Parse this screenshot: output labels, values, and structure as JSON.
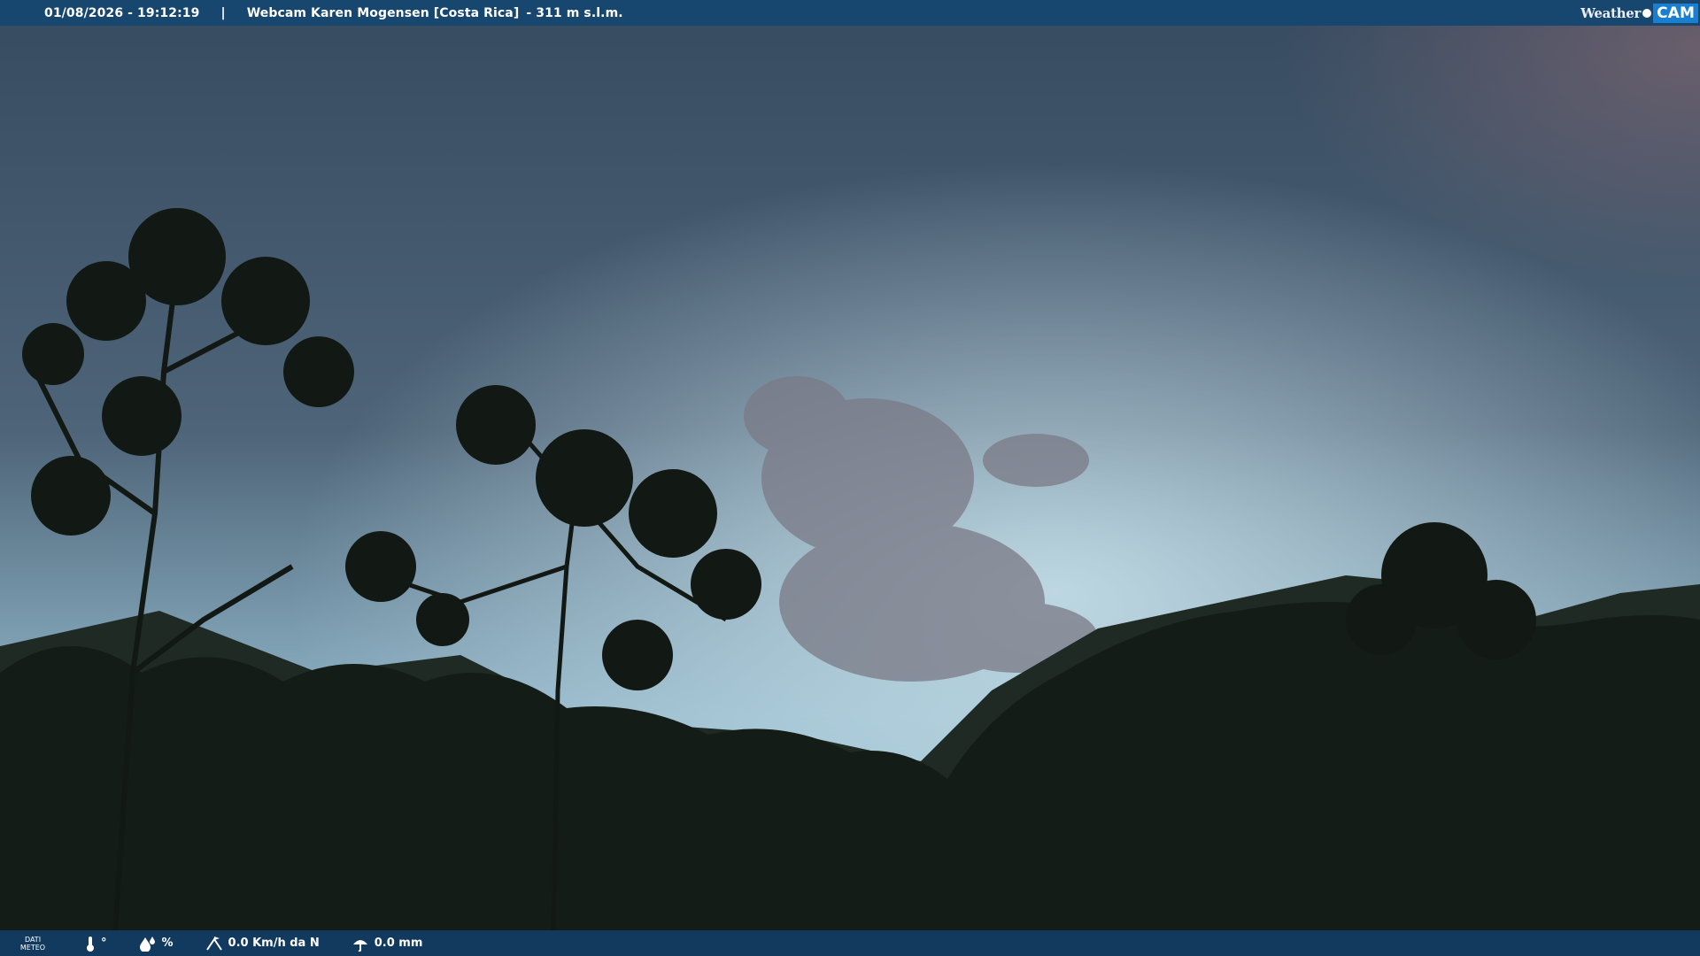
{
  "header": {
    "datetime": "01/08/2026 - 19:12:19",
    "separator": "|",
    "title": "Webcam Karen Mogensen [Costa Rica]",
    "altitude": "- 311 m s.l.m.",
    "logo_weather": "Weather",
    "logo_cam": "CAM"
  },
  "footer": {
    "dati_line1": "DATI",
    "dati_line2": "METEO",
    "temperature": "°",
    "humidity": "%",
    "wind": "0.0 Km/h da N",
    "rain": "0.0 mm"
  },
  "icons": {
    "temperature": "thermometer-icon",
    "humidity": "humidity-icon",
    "wind": "wind-icon",
    "rain": "rain-icon"
  },
  "colors": {
    "header_bg": "#17466f",
    "footer_bg": "#123a5e",
    "logo_accent": "#1b7fd0"
  }
}
